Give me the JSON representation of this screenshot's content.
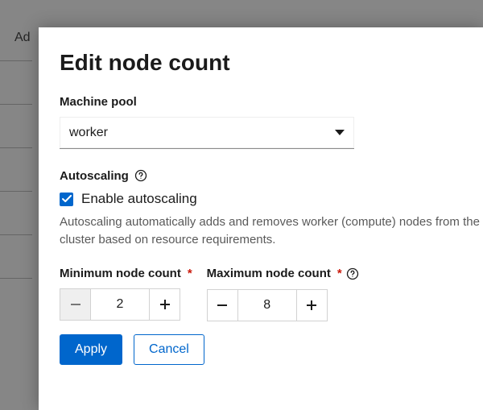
{
  "background": {
    "truncated_text": "Ad"
  },
  "modal": {
    "title": "Edit node count",
    "machine_pool": {
      "label": "Machine pool",
      "selected": "worker"
    },
    "autoscaling": {
      "section_label": "Autoscaling",
      "checkbox_label": "Enable autoscaling",
      "checked": true,
      "description": "Autoscaling automatically adds and removes worker (compute) nodes from the cluster based on resource requirements."
    },
    "min": {
      "label": "Minimum node count",
      "value": "2",
      "minus_disabled": true
    },
    "max": {
      "label": "Maximum node count",
      "value": "8",
      "minus_disabled": false
    },
    "actions": {
      "apply": "Apply",
      "cancel": "Cancel"
    }
  }
}
